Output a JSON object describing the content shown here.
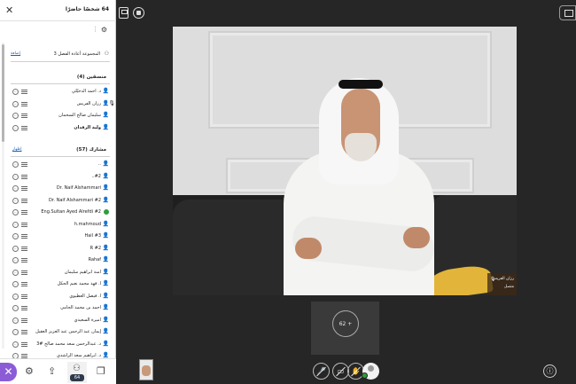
{
  "panel": {
    "title": "64 شخصًا حاضرًا",
    "close_icon": "close-icon",
    "settings_icon": "gear-icon",
    "group": {
      "name": "المجموعة أعادة الفصل 3",
      "action": "إضافة"
    },
    "facilitators": {
      "heading": "منسقين (4)",
      "items": [
        {
          "name": "د. أحمد الدخيّلي",
          "bold": false
        },
        {
          "name": "رزان الفريس",
          "bold": false,
          "mic": true
        },
        {
          "name": "سليمان صالح السحمان",
          "bold": false
        },
        {
          "name": "ولية الرفدان",
          "bold": true
        }
      ]
    },
    "participants": {
      "heading": "مشارك (57)",
      "sub": "إظهار",
      "items": [
        {
          "name": "..",
          "bold": false
        },
        {
          "name": "..#2",
          "bold": false
        },
        {
          "name": "Dr. Naif Alshammari",
          "bold": false
        },
        {
          "name": "Dr. Naif Alshammari #2",
          "bold": false
        },
        {
          "name": "Eng.Sultan Ayed Alrefdi #2",
          "bold": false,
          "status": "online"
        },
        {
          "name": "h.mahmoud",
          "bold": false
        },
        {
          "name": "Hail #3",
          "bold": false
        },
        {
          "name": "R #2",
          "bold": false
        },
        {
          "name": "Rahaf",
          "bold": false
        },
        {
          "name": "آمنة ابراهيم سليمان",
          "bold": false
        },
        {
          "name": "أ. فهد محمد نعيم الحكل",
          "bold": false
        },
        {
          "name": "أ. فيصل العطيوي",
          "bold": false
        },
        {
          "name": "أحمد بن محمد الحامي",
          "bold": false
        },
        {
          "name": "أميرة السعيدي",
          "bold": false
        },
        {
          "name": "إيمان عبد الرحمن عبد العزيز العقيل",
          "bold": false
        },
        {
          "name": "د. عبدالرحمن سعد محمد صالح #3",
          "bold": false
        },
        {
          "name": "د. ابراهيم سعد الراشدي",
          "bold": false
        }
      ]
    },
    "nav": {
      "close_icon": "close-icon",
      "settings_icon": "gear-icon",
      "share_icon": "share-icon",
      "people_count": "64",
      "chat_icon": "chat-icon"
    }
  },
  "stage": {
    "speaker_name": "رزان الفريس",
    "speaker_tag": "متصل",
    "overflow_count": "62 +",
    "controls": [
      "microphone-icon",
      "camera-icon",
      "hand-raise-icon",
      "avatar-icon"
    ],
    "help_icon": "help-icon"
  }
}
